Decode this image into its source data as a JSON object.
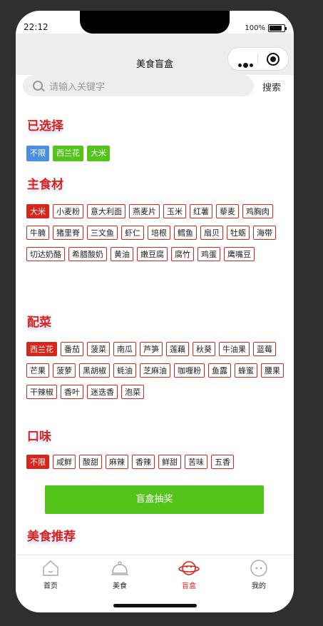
{
  "status": {
    "time": "22:12",
    "battery": "100%"
  },
  "nav": {
    "title": "美食盲盒"
  },
  "search": {
    "placeholder": "请输入关键字",
    "button": "搜索"
  },
  "selected": {
    "title": "已选择",
    "items": [
      {
        "label": "不限",
        "color": "#4a90e2"
      },
      {
        "label": "西兰花",
        "color": "#52c41a"
      },
      {
        "label": "大米",
        "color": "#52c41a"
      }
    ]
  },
  "main_ingredients": {
    "title": "主食材",
    "items": [
      "大米",
      "小麦粉",
      "意大利面",
      "燕麦片",
      "玉米",
      "红薯",
      "藜麦",
      "鸡胸肉",
      "牛腩",
      "猪里脊",
      "三文鱼",
      "虾仁",
      "培根",
      "鳕鱼",
      "扇贝",
      "牡蛎",
      "海带",
      "切达奶酪",
      "希腊酸奶",
      "黄油",
      "嫩豆腐",
      "腐竹",
      "鸡蛋",
      "鹰嘴豆"
    ],
    "active": 0
  },
  "side_dishes": {
    "title": "配菜",
    "items": [
      "西兰花",
      "番茄",
      "菠菜",
      "南瓜",
      "芦笋",
      "莲藕",
      "秋葵",
      "牛油果",
      "蓝莓",
      "芒果",
      "菠萝",
      "黑胡椒",
      "蚝油",
      "芝麻油",
      "咖喱粉",
      "鱼露",
      "蜂蜜",
      "腰果",
      "干辣椒",
      "香叶",
      "迷迭香",
      "泡菜"
    ],
    "active": 0
  },
  "flavors": {
    "title": "口味",
    "items": [
      "不限",
      "咸鲜",
      "酸甜",
      "麻辣",
      "香辣",
      "鲜甜",
      "苦味",
      "五香"
    ],
    "active": 0
  },
  "draw_button": "盲盒抽奖",
  "recommend_title": "美食推荐",
  "tabs": [
    {
      "label": "首页",
      "icon": "home-icon"
    },
    {
      "label": "美食",
      "icon": "food-cloche-icon"
    },
    {
      "label": "盲盒",
      "icon": "blind-box-icon",
      "active": true
    },
    {
      "label": "我的",
      "icon": "profile-icon"
    }
  ],
  "accent": "#d9261c"
}
